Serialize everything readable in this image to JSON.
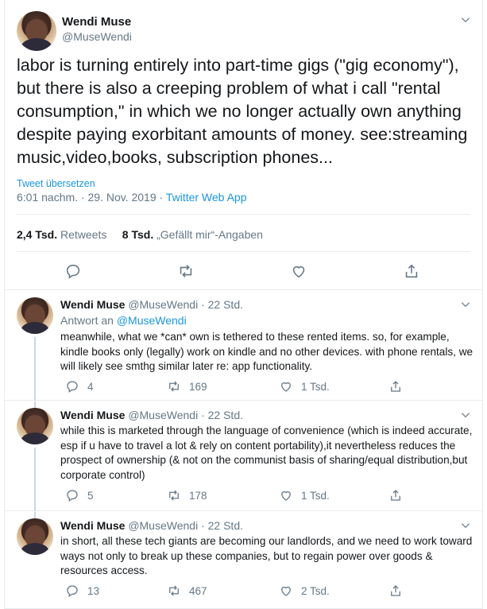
{
  "main_tweet": {
    "name": "Wendi Muse",
    "handle": "@MuseWendi",
    "text": "labor is turning entirely into part-time gigs (\"gig economy\"), but there is also a creeping problem of what i call \"rental consumption,\" in which we no longer actually own anything despite paying exorbitant amounts of money. see:streaming music,video,books, subscription phones...",
    "translate": "Tweet übersetzen",
    "time": "6:01 nachm. · 29. Nov. 2019 · ",
    "source": "Twitter Web App",
    "retweets_count": "2,4 Tsd.",
    "retweets_label": "Retweets",
    "likes_count": "8 Tsd.",
    "likes_label": "„Gefällt mir“-Angaben"
  },
  "replies": [
    {
      "name": "Wendi Muse",
      "handle": "@MuseWendi · 22 Std.",
      "reply_to_label": "Antwort an ",
      "reply_to_handle": "@MuseWendi",
      "text": "meanwhile, what we *can* own is tethered to these rented items. so, for example, kindle books only (legally) work on kindle and no other devices. with phone rentals, we will likely see smthg similar later re: app functionality.",
      "replies": "4",
      "retweets": "169",
      "likes": "1 Tsd."
    },
    {
      "name": "Wendi Muse",
      "handle": "@MuseWendi · 22 Std.",
      "text": "while this is marketed through the language of convenience (which is indeed accurate, esp if u have to travel a lot & rely on content portability),it nevertheless reduces the prospect of ownership (& not on the communist basis of sharing/equal distribution,but corporate control)",
      "replies": "5",
      "retweets": "178",
      "likes": "1 Tsd."
    },
    {
      "name": "Wendi Muse",
      "handle": "@MuseWendi · 22 Std.",
      "text": "in short, all these tech giants are becoming our landlords, and we need to work toward ways not only to break up these companies, but to regain power over goods & resources access.",
      "replies": "13",
      "retweets": "467",
      "likes": "2 Tsd."
    }
  ],
  "icons": {
    "reply": "reply-icon",
    "retweet": "retweet-icon",
    "like": "heart-icon",
    "share": "share-icon",
    "menu": "chevron-down-icon"
  },
  "colors": {
    "link": "#1b95e0",
    "secondary": "#657786",
    "border": "#e6ecf0"
  }
}
